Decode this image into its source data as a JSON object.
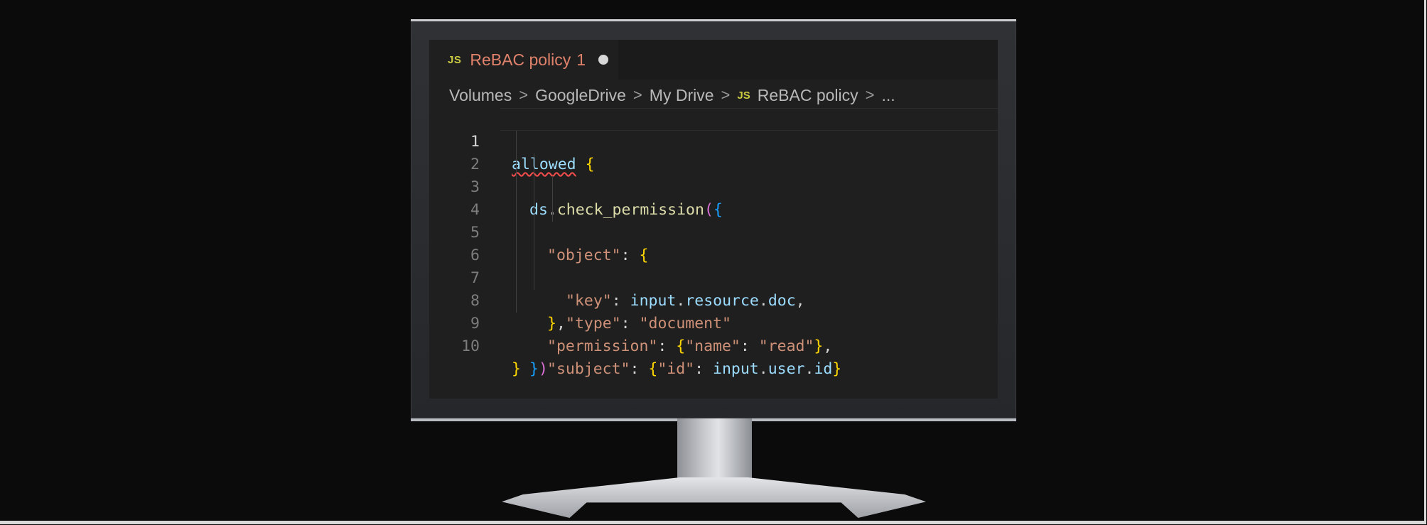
{
  "tab": {
    "file_type_badge": "JS",
    "label": "ReBAC policy",
    "problem_count": "1",
    "modified_indicator_icon": "unsaved-dot-icon"
  },
  "breadcrumb": {
    "items": [
      "Volumes",
      "GoogleDrive",
      "My Drive"
    ],
    "file_type_badge": "JS",
    "file": "ReBAC policy",
    "ellipsis": "...",
    "separator": ">"
  },
  "editor": {
    "line_numbers": [
      "1",
      "2",
      "3",
      "4",
      "5",
      "6",
      "7",
      "8",
      "9",
      "10"
    ],
    "lines": [
      "allowed {",
      "ds.check_permission({",
      "\"object\": {",
      "\"key\": input.resource.doc,",
      "\"type\": \"document\"",
      "},",
      "\"permission\": {\"name\": \"read\"},",
      "\"subject\": {\"id\": input.user.id}",
      "})",
      "}"
    ]
  },
  "colors": {
    "tab_label": "#e0826b",
    "js_badge": "#cbcb41",
    "identifier": "#9cdcfe",
    "string": "#ce9178",
    "function": "#dcdcaa",
    "bracket_gold": "#ffd700",
    "bracket_purple": "#da70d6",
    "bracket_blue": "#179fff",
    "error_squiggle": "#f14c4c",
    "editor_background": "#1f1f1f"
  }
}
